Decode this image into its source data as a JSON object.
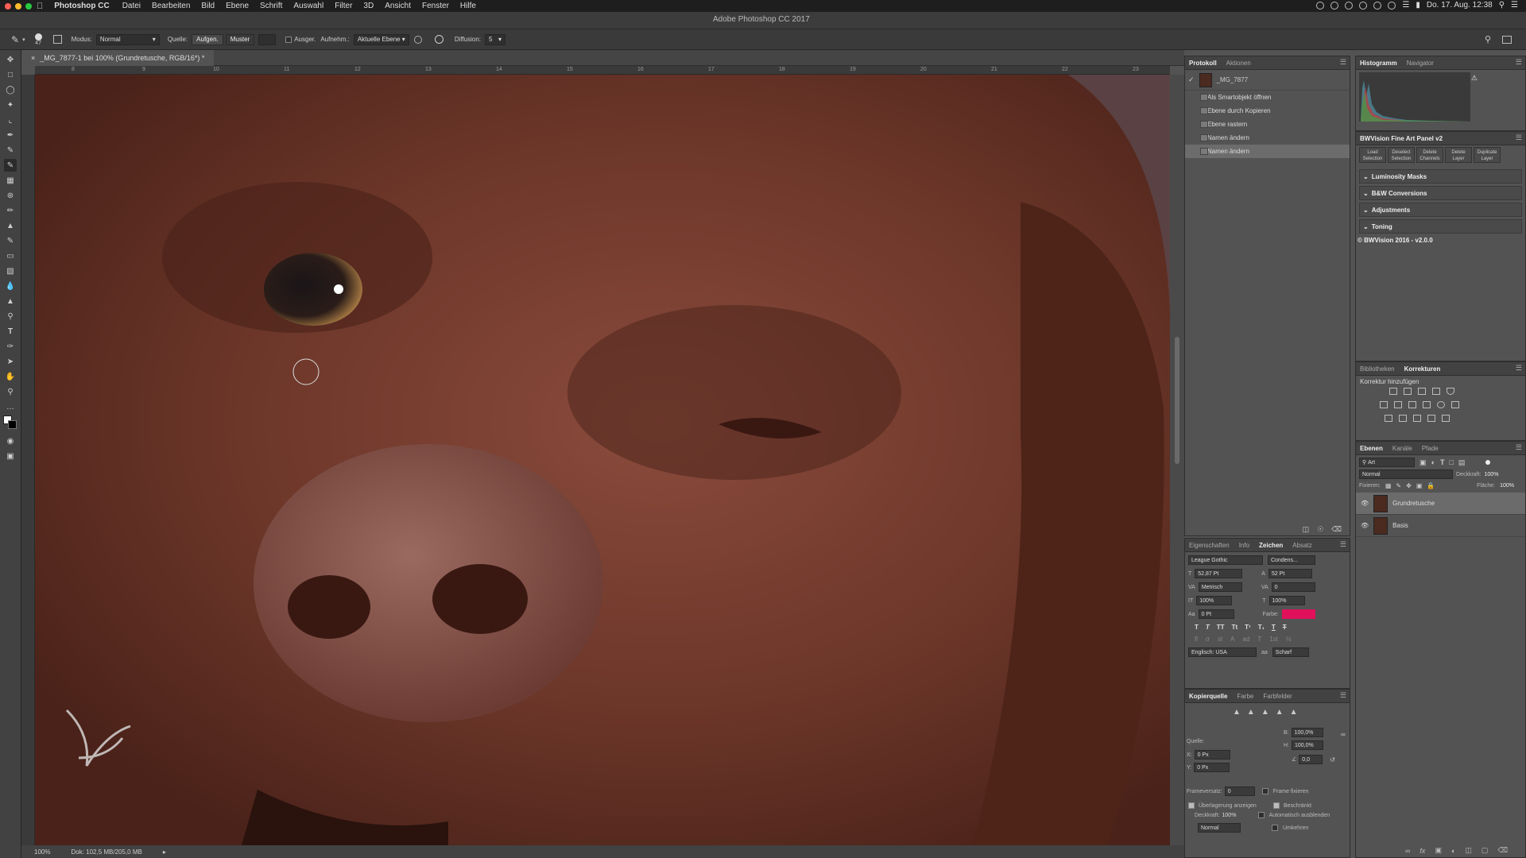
{
  "menubar": {
    "app_name": "Photoshop CC",
    "items": [
      "Datei",
      "Bearbeiten",
      "Bild",
      "Ebene",
      "Schrift",
      "Auswahl",
      "Filter",
      "3D",
      "Ansicht",
      "Fenster",
      "Hilfe"
    ],
    "clock": "Do. 17. Aug. 12:38"
  },
  "window": {
    "title": "Adobe Photoshop CC 2017"
  },
  "options": {
    "brush_size": "47",
    "mode_label": "Modus:",
    "mode_value": "Normal",
    "source_label": "Quelle:",
    "source_sampled": "Aufgen.",
    "source_pattern": "Muster",
    "aligned_label": "Ausger.",
    "sample_label": "Aufnehm.:",
    "sample_value": "Aktuelle Ebene",
    "diffusion_label": "Diffusion:",
    "diffusion_value": "5"
  },
  "document": {
    "tab_label": "_MG_7877-1 bei 100% (Grundretusche, RGB/16*) *",
    "zoom": "100%",
    "doc_info": "Dok: 102,5 MB/205,0 MB",
    "ruler_ticks": [
      "8",
      "9",
      "10",
      "11",
      "12",
      "13",
      "14",
      "15",
      "16",
      "17",
      "18",
      "19",
      "20",
      "21",
      "22",
      "23"
    ]
  },
  "history_panel": {
    "tabs": [
      "Protokoll",
      "Aktionen"
    ],
    "snapshot": "_MG_7877",
    "items": [
      "Als Smartobjekt öffnen",
      "Ebene durch Kopieren",
      "Ebene rastern",
      "Namen ändern",
      "Namen ändern"
    ]
  },
  "histogram_panel": {
    "tabs": [
      "Histogramm",
      "Navigator"
    ]
  },
  "bwvision_panel": {
    "title": "BWVision Fine Art Panel v2",
    "buttons": [
      {
        "line1": "Load",
        "line2": "Selection"
      },
      {
        "line1": "Deselect",
        "line2": "Selection"
      },
      {
        "line1": "Delete",
        "line2": "Channels"
      },
      {
        "line1": "Delete",
        "line2": "Layer"
      },
      {
        "line1": "Duplicate",
        "line2": "Layer"
      }
    ],
    "sections": [
      "Luminosity Masks",
      "B&W Conversions",
      "Adjustments",
      "Toning"
    ],
    "footer": "© BWVision 2016 - v2.0.0"
  },
  "adjustments_panel": {
    "tabs": [
      "Bibliotheken",
      "Korrekturen"
    ],
    "heading": "Korrektur hinzufügen"
  },
  "layers_panel": {
    "tabs": [
      "Ebenen",
      "Kanäle",
      "Pfade"
    ],
    "filter": "Art",
    "blend_mode": "Normal",
    "opacity_label": "Deckkraft:",
    "opacity_value": "100%",
    "lock_label": "Fixieren:",
    "fill_label": "Fläche:",
    "fill_value": "100%",
    "layers": [
      {
        "name": "Grundretusche",
        "selected": true
      },
      {
        "name": "Basis",
        "selected": false
      }
    ]
  },
  "character_panel": {
    "tabs": [
      "Eigenschaften",
      "Info",
      "Zeichen",
      "Absatz"
    ],
    "font_family": "League Gothic",
    "font_style": "Condens...",
    "font_size": "52,87 Pt",
    "leading": "52 Pt",
    "kerning": "Metrisch",
    "tracking": "0",
    "vertical_scale": "100%",
    "horizontal_scale": "100%",
    "baseline_shift": "0 Pt",
    "color_label": "Farbe:",
    "color_value": "#e0105a",
    "language": "Englisch: USA",
    "antialias": "Scharf"
  },
  "clone_source_panel": {
    "tabs": [
      "Kopierquelle",
      "Farbe",
      "Farbfelder"
    ],
    "source_label": "Quelle:",
    "x_label": "X:",
    "x_value": "0 Px",
    "y_label": "Y:",
    "y_value": "0 Px",
    "w_label": "B:",
    "w_value": "100,0%",
    "h_label": "H:",
    "h_value": "100,0%",
    "angle_value": "0,0",
    "frame_offset_label": "Frameversatz:",
    "frame_offset_value": "0",
    "frame_lock_label": "Frame fixieren",
    "show_overlay_label": "Überlagerung anzeigen",
    "clipped_label": "Beschränkt",
    "opacity_label": "Deckkraft:",
    "opacity_value": "100%",
    "auto_hide_label": "Automatisch ausblenden",
    "blend_value": "Normal",
    "invert_label": "Umkehren"
  }
}
